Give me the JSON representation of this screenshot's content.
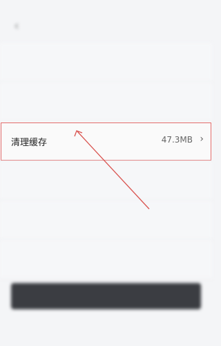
{
  "status_bar": {
    "time": "",
    "icons": ""
  },
  "header": {
    "title": "",
    "back_icon": "chevron-left-icon"
  },
  "rows": [
    {
      "label": "",
      "value": "",
      "chevron": ""
    },
    {
      "label": "",
      "value": "",
      "chevron": ""
    },
    {
      "label": "清理缓存",
      "value": "47.3MB",
      "chevron": "›"
    },
    {
      "label": "",
      "value": "",
      "chevron": ""
    },
    {
      "label": "",
      "value": "",
      "chevron": ""
    },
    {
      "label": "",
      "value": "",
      "chevron": ""
    }
  ],
  "logout": {
    "label": ""
  },
  "colors": {
    "highlight": "#e06a6a",
    "button": "#3b3d42",
    "background": "#f4f5f7"
  }
}
